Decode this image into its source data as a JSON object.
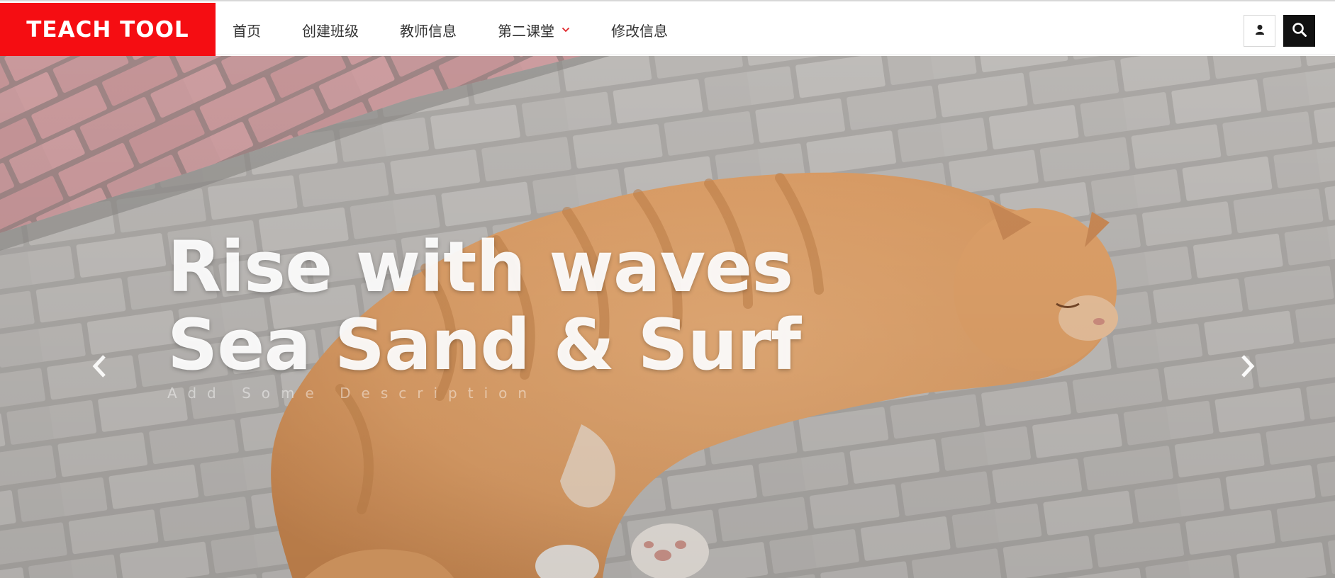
{
  "header": {
    "brand": "TEACH TOOL",
    "nav": [
      {
        "label": "首页"
      },
      {
        "label": "创建班级"
      },
      {
        "label": "教师信息"
      },
      {
        "label": "第二课堂",
        "has_dropdown": true
      },
      {
        "label": "修改信息"
      }
    ],
    "icons": {
      "user": "user-icon",
      "search": "search-icon",
      "dropdown": "chevron-down-icon"
    }
  },
  "hero": {
    "title_line1": "Rise with waves",
    "title_line2": "Sea Sand & Surf",
    "description": "Add Some Description",
    "prev_icon": "chevron-left-icon",
    "next_icon": "chevron-right-icon",
    "image": "sleeping-orange-cat-on-pavement"
  },
  "colors": {
    "brand_bg": "#f50d12",
    "nav_text": "#333333",
    "chevron": "#e0262a",
    "search_bg": "#111111"
  }
}
